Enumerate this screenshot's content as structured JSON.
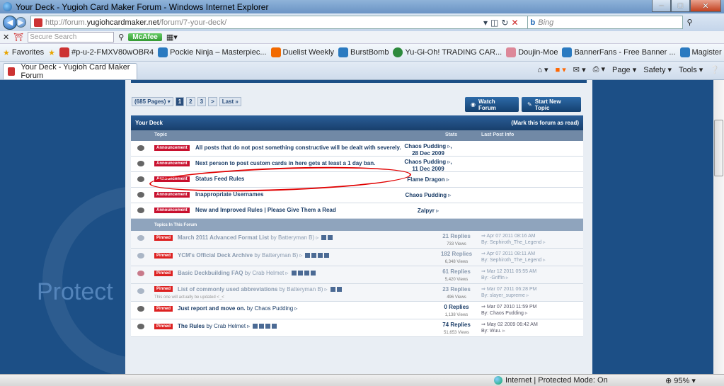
{
  "window": {
    "title": "Your Deck - Yugioh Card Maker Forum - Windows Internet Explorer"
  },
  "address": {
    "host_prefix": "http://forum.",
    "host": "yugiohcardmaker.net",
    "path": "/forum/7-your-deck/"
  },
  "search": {
    "placeholder": "Bing"
  },
  "security": {
    "placeholder": "Secure Search",
    "mcafee_label": "McAfee"
  },
  "favorites": {
    "label": "Favorites",
    "items": [
      "#p-u-2-FMXV80wOBR4",
      "Pockie Ninja – Masterpiec...",
      "Duelist Weekly",
      "BurstBomb",
      "Yu-Gi-Oh! TRADING CAR...",
      "Doujin-Moe",
      "BannerFans - Free Banner ...",
      "Magister Negi Magi Galer..."
    ]
  },
  "tab": {
    "label": "Your Deck - Yugioh Card Maker Forum"
  },
  "commandbar": {
    "page": "Page ▾",
    "safety": "Safety ▾",
    "tools": "Tools ▾"
  },
  "watermark": {
    "text": "Protect"
  },
  "pagination": {
    "label": "(685 Pages) ▾",
    "pages": [
      "1",
      "2",
      "3",
      ">",
      "Last »"
    ]
  },
  "buttons": {
    "watch": "Watch Forum",
    "start": "Start New Topic"
  },
  "forum": {
    "title": "Your Deck",
    "mark_read": "(Mark this forum as read)",
    "col_topic": "Topic",
    "col_stats": "Stats",
    "col_last": "Last Post Info",
    "announcement_tag": "Announcement",
    "announcements": [
      {
        "title": "All posts that do not post something constructive will be dealt with severely.",
        "author": "Chaos Pudding",
        "date": "28 Dec 2009"
      },
      {
        "title": "Next person to post custom cards in here gets at least a 1 day ban.",
        "author": "Chaos Pudding",
        "date": "11 Dec 2009"
      },
      {
        "title": "Status Feed Rules",
        "author": "Flame Dragon",
        "date": ""
      },
      {
        "title": "Inappropriate Usernames",
        "author": "Chaos Pudding",
        "date": ""
      },
      {
        "title": "New and Improved Rules | Please Give Them a Read",
        "author": "Zalpyr",
        "date": ""
      }
    ],
    "subheader": "Topics In This Forum",
    "pinned_tag": "Pinned",
    "topics": [
      {
        "title": "March 2011 Advanced Format List",
        "by": "by Batteryman B)",
        "replies": "21 Replies",
        "views": "733 Views",
        "last_date": "Apr 07 2011 08:16 AM",
        "last_by": "By: Sephiroth_The_Legend",
        "desc": ""
      },
      {
        "title": "YCM's Official Deck Archive",
        "by": "by Batteryman B)",
        "replies": "182 Replies",
        "views": "6,348 Views",
        "last_date": "Apr 07 2011 08:11 AM",
        "last_by": "By: Sephiroth_The_Legend",
        "desc": ""
      },
      {
        "title": "Basic Deckbuilding FAQ",
        "by": "by Crab Helmet",
        "replies": "61 Replies",
        "views": "5,420 Views",
        "last_date": "Mar 12 2011 05:55 AM",
        "last_by": "By: -Griffin",
        "desc": ""
      },
      {
        "title": "List of commonly used abbreviations",
        "by": "by Batteryman B)",
        "replies": "23 Replies",
        "views": "496 Views",
        "last_date": "Mar 07 2011 06:28 PM",
        "last_by": "By: slayer_supreme",
        "desc": "This one will actually be updated <_<"
      },
      {
        "title": "Just report and move on.",
        "by": "by Chaos Pudding",
        "replies": "0 Replies",
        "views": "1,138 Views",
        "last_date": "Mar 07 2010 11:59 PM",
        "last_by": "By: Chaos Pudding",
        "desc": ""
      },
      {
        "title": "The Rules",
        "by": "by Crab Helmet",
        "replies": "74 Replies",
        "views": "51,653 Views",
        "last_date": "May 02 2009 06:42 AM",
        "last_by": "By: Wuu.",
        "desc": ""
      }
    ]
  },
  "status": {
    "zone": "Internet | Protected Mode: On",
    "zoom": "⊕ 95% ▾"
  }
}
